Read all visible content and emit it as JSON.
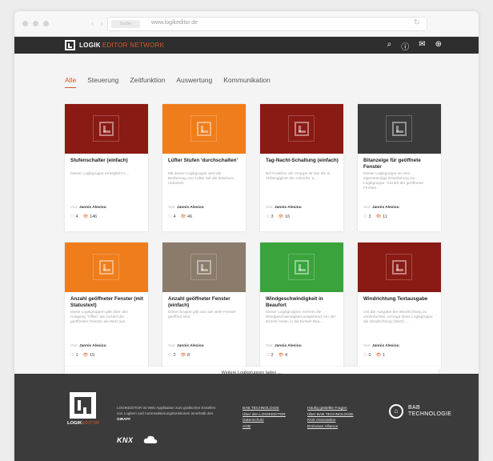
{
  "browser": {
    "address": "www.logikeditor.de",
    "tab_placeholder": "Suche"
  },
  "header": {
    "logo_bold": "LOGIK",
    "logo_light": "EDITOR NETWORK"
  },
  "tabs": [
    {
      "label": "Alle"
    },
    {
      "label": "Steuerung"
    },
    {
      "label": "Zeitfunktion"
    },
    {
      "label": "Auswertung"
    },
    {
      "label": "Kommunikation"
    }
  ],
  "cards": [
    {
      "title": "Stufenschalter (einfach)",
      "desc": "Dieser Logikgruppe ermöglicht s…",
      "author_prefix": "Von:",
      "author": "Jannis Alexiou",
      "likes": "4",
      "views": "146",
      "color": "#8a1a14"
    },
    {
      "title": "Lüfter Stufen 'durchschalten'",
      "desc": "Mit dieser Logikgruppe wird die Bedienung von Lüfter auf die Minimum reduziert.",
      "author_prefix": "Von:",
      "author": "Jannis Alexiou",
      "likes": "4",
      "views": "46",
      "color": "#ef7d1c"
    },
    {
      "title": "Tag-Nacht-Schaltung (einfach)",
      "desc": "Bei Funktion der Gruppe ist das die in Abhängigkeit der Astrouhr, a…",
      "author_prefix": "Von:",
      "author": "Jannis Alexiou",
      "likes": "3",
      "views": "16",
      "color": "#8a1a14"
    },
    {
      "title": "Bitanzeige für geöffnete Fenster",
      "desc": "Dieser Logikgruppe ist eine eigenständige Erweiterung zur Logikgruppe \"Anzahl der geöffneter Fenster…",
      "author_prefix": "Von:",
      "author": "Jannis Alexiou",
      "likes": "3",
      "views": "11",
      "color": "#3a3a3a"
    },
    {
      "title": "Anzahl geöffneter Fenster (mit Statustext)",
      "desc": "Diese Logikgruppen gibt über den Ausgang \"Offen\" die Anzahl der geöffneten Fenster als Wert aus.",
      "author_prefix": "Von:",
      "author": "Jannis Alexiou",
      "likes": "1",
      "views": "15",
      "color": "#ef7d1c"
    },
    {
      "title": "Anzahl geöffneter Fenster (einfach)",
      "desc": "Diese Gruppe gibt aus wie viele Fenster geöffnet sind.",
      "author_prefix": "Von:",
      "author": "Jannis Alexiou",
      "likes": "2",
      "views": "8",
      "color": "#8b7b6b"
    },
    {
      "title": "Windgeschwindigkeit in Beaufort",
      "desc": "Dieser Logikgruppen rechnet die Windgeschwindigkeit ausgehend von der Einheit m/sec in die Einheit Bea…",
      "author_prefix": "Von:",
      "author": "Jannis Alexiou",
      "likes": "2",
      "views": "4",
      "color": "#3aa33c"
    },
    {
      "title": "Windrichtung Textausgabe",
      "desc": "Um die Ausgabe der Windrichtung zu vereinfachen, erzeugt diese Logikgruppe die Windrichtung (NNO) …",
      "author_prefix": "Von:",
      "author": "Jannis Alexiou",
      "likes": "0",
      "views": "1",
      "color": "#8a1a14"
    }
  ],
  "more_button": "Weitere Logikgruppen laden …",
  "footer": {
    "logo_bold": "LOGIK",
    "logo_light": "EDITOR",
    "about_1": "LOGIKEDITOR ist Web-Applikation zum grafischen Erstellen von Logiken und Automatisierungsfunktionen innerhalb des ",
    "about_brand": "GIRAFF",
    "about_end": ".",
    "brand_knx": "KNX",
    "col1": [
      "BAB TECHNOLOGIE",
      "Über den LOGIKEDITOR",
      "Datenschutz",
      "AGB"
    ],
    "col2": [
      "Häufig gestellte Fragen",
      "Über BAB TECHNOLOGIE",
      "KNX Association",
      "Embosan Alliance"
    ],
    "bab_line1": "BAB",
    "bab_line2": "TECHNOLOGIE"
  }
}
